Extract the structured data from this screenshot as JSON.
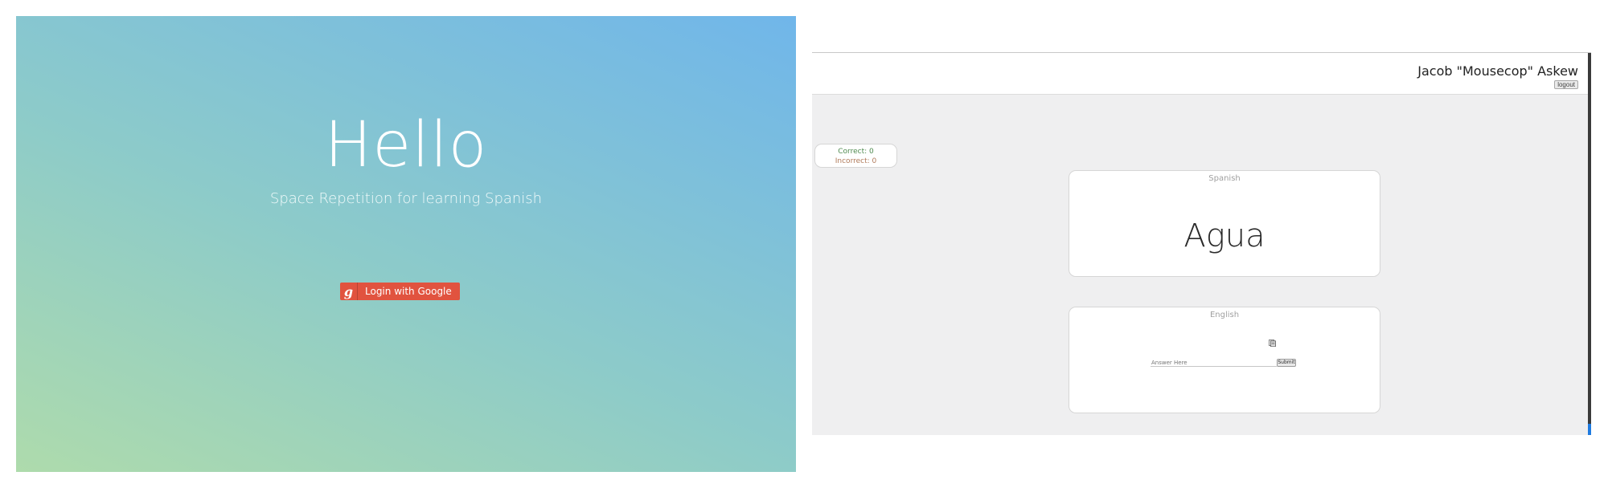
{
  "landing": {
    "heading": "Hello",
    "subtitle": "Space Repetition for learning Spanish",
    "login_button": {
      "icon_glyph": "g",
      "label": "Login with Google"
    },
    "colors": {
      "gradient_start": "#aedbac",
      "gradient_end": "#70b6ea",
      "google_button": "#e1533f"
    }
  },
  "app": {
    "header": {
      "user_name": "Jacob \"Mousecop\" Askew",
      "logout_label": "logout"
    },
    "score": {
      "correct_label": "Correct: 0",
      "incorrect_label": "Incorrect: 0"
    },
    "spanish_card": {
      "label": "Spanish",
      "word": "Agua"
    },
    "english_card": {
      "label": "English",
      "answer_placeholder": "Answer Here",
      "submit_label": "Submit",
      "icon": "document-icon"
    },
    "colors": {
      "background": "#efeff0",
      "card": "#ffffff",
      "scroll_accent": "#1f7be0"
    }
  }
}
